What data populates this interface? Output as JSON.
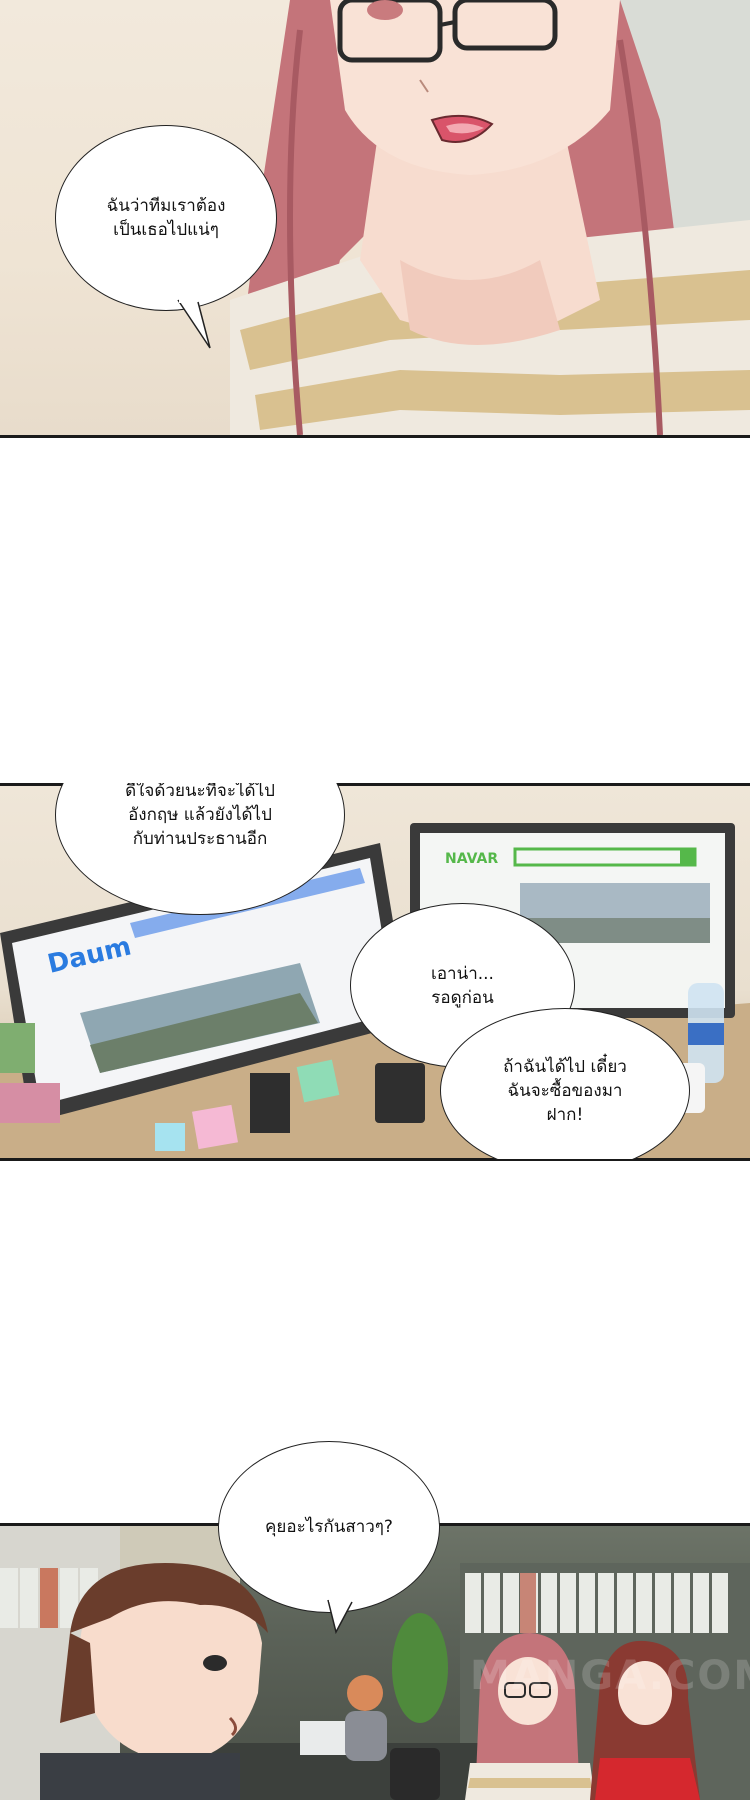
{
  "bubbles": {
    "b1": "ฉันว่าทีมเราต้อง\nเป็นเธอไปแน่ๆ",
    "b2": "ดีใจด้วยนะที่จะได้ไป\nอังกฤษ แล้วยังได้ไป\nกับท่านประธานอีก",
    "b3": "เอาน่า...\nรอดูก่อน",
    "b4": "ถ้าฉันได้ไป เดี๋ยว\nฉันจะซื้อของมา\nฝาก!",
    "b5": "คุยอะไรกันสาวๆ?"
  },
  "monitors": {
    "left_logo": "Daum",
    "right_logo": "NAVAR"
  },
  "watermark": "MANGA.COM",
  "colors": {
    "hair_pink": "#c8767a",
    "skin": "#f7dccf",
    "stripe_tan": "#d8c08f",
    "monitor_frame": "#3a3a3a",
    "plant_green": "#4f8a3c"
  }
}
